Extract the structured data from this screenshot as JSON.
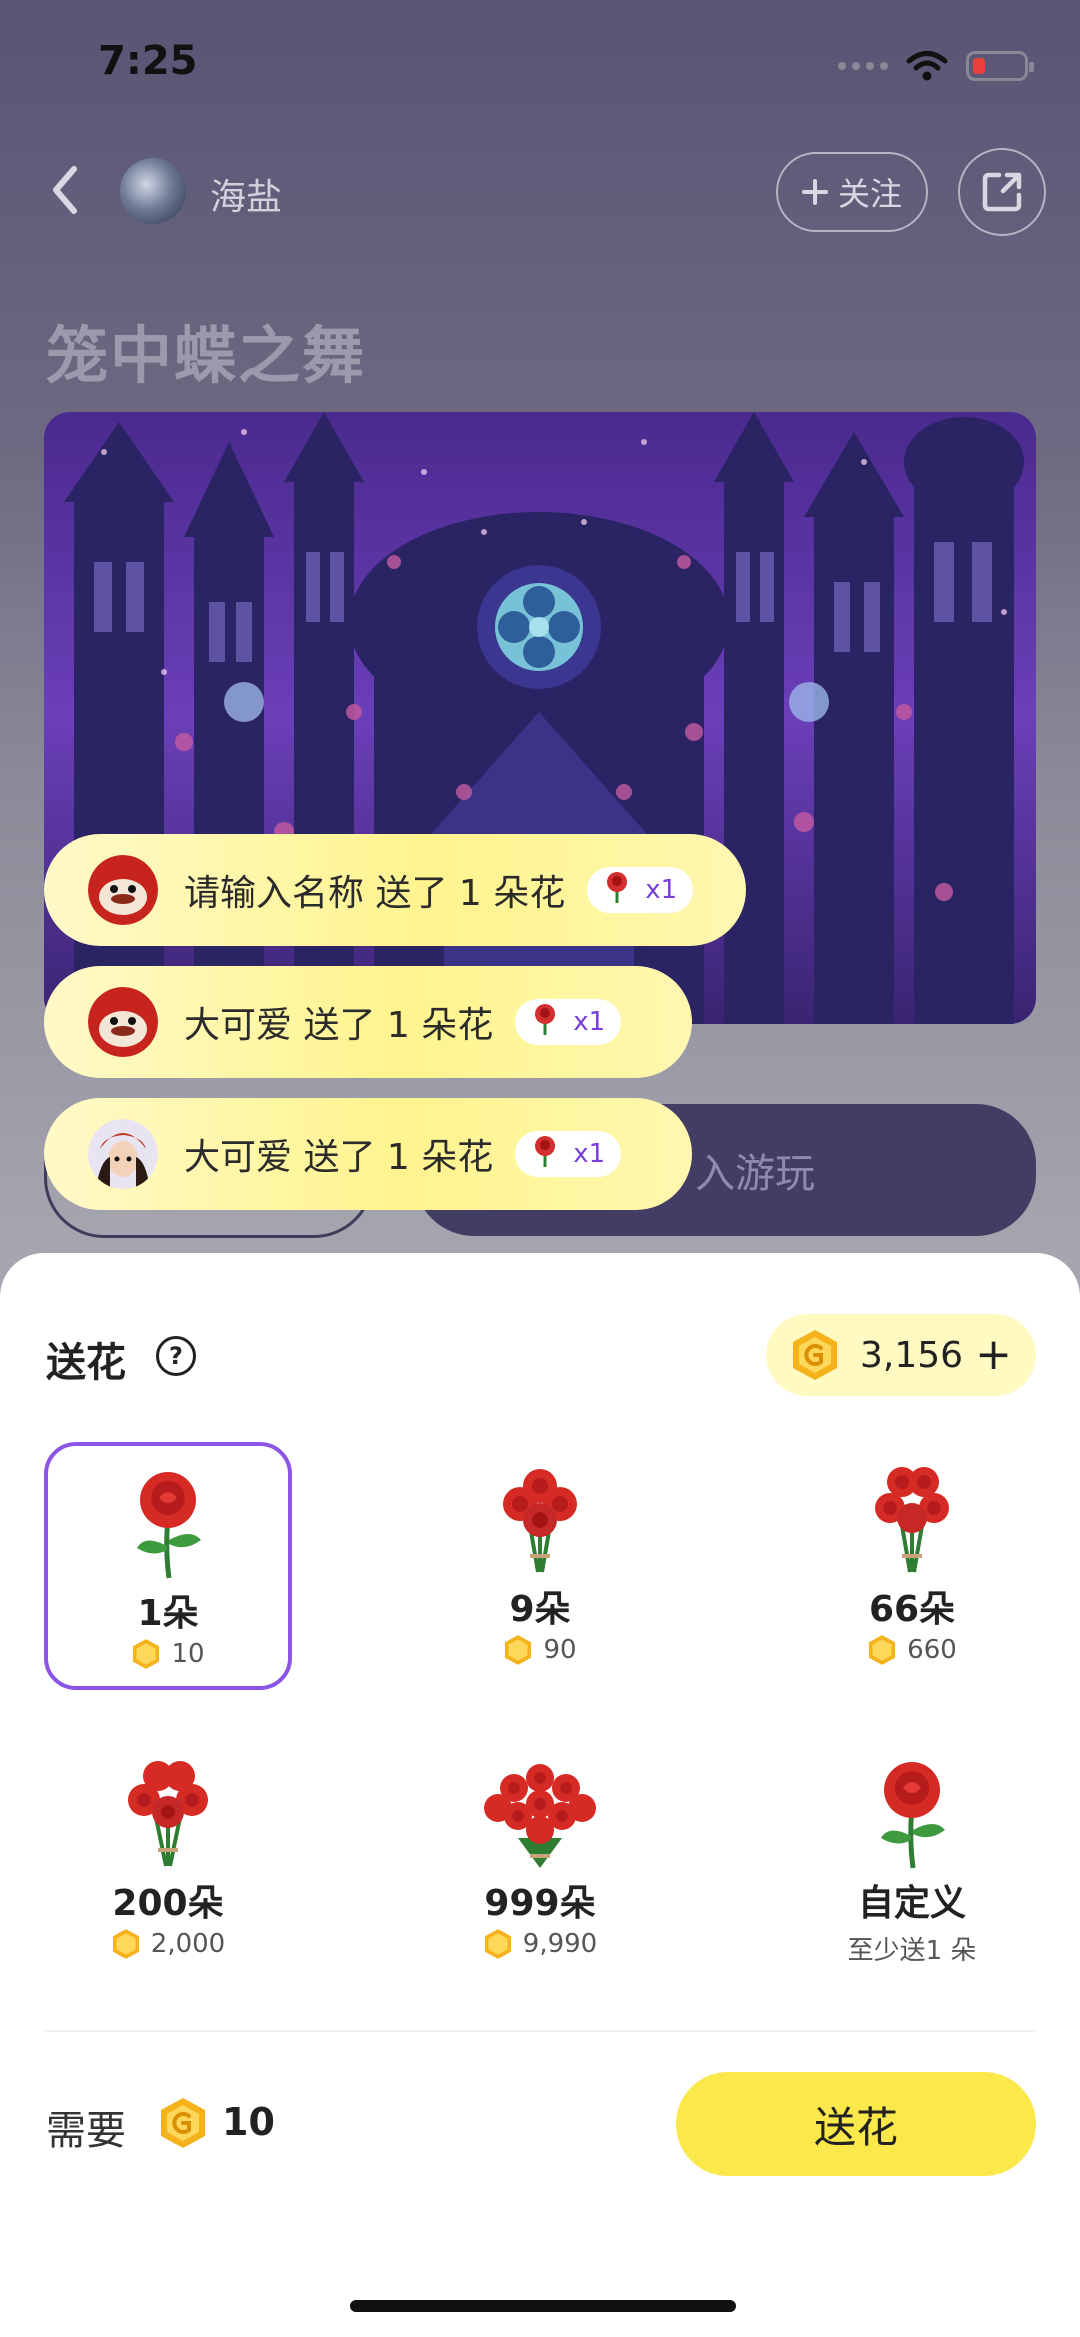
{
  "status_bar": {
    "time": "7:25"
  },
  "header": {
    "author_name": "海盐",
    "follow_label": "关注",
    "title": "笼中蝶之舞"
  },
  "play_button_label": "入游玩",
  "toasts": [
    {
      "user": "请输入名称",
      "text": "送了 1 朵花",
      "count": "x1"
    },
    {
      "user": "大可爱",
      "text": "送了 1 朵花",
      "count": "x1"
    },
    {
      "user": "大可爱",
      "text": "送了 1 朵花",
      "count": "x1"
    }
  ],
  "sheet": {
    "title": "送花",
    "balance": "3,156",
    "options": [
      {
        "name": "1朵",
        "price": "10",
        "selected": true
      },
      {
        "name": "9朵",
        "price": "90"
      },
      {
        "name": "66朵",
        "price": "660"
      },
      {
        "name": "200朵",
        "price": "2,000"
      },
      {
        "name": "999朵",
        "price": "9,990"
      },
      {
        "name": "自定义",
        "sub": "至少送1 朵"
      }
    ],
    "need_label": "需要",
    "need_value": "10",
    "send_label": "送花"
  },
  "colors": {
    "accent": "#8b55e6",
    "button_yellow": "#fbe84a",
    "coin": "#f6b21a"
  }
}
